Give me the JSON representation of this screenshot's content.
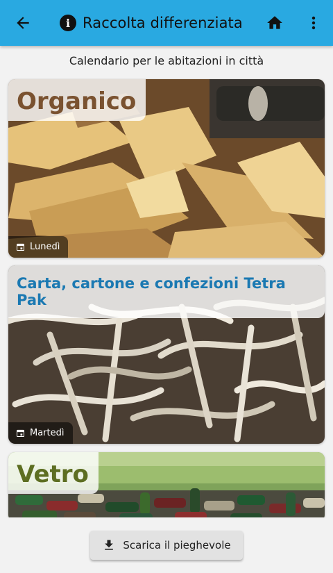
{
  "appbar": {
    "title": "Raccolta differenziata",
    "back_icon": "arrow-back-icon",
    "info_icon": "info-icon",
    "home_icon": "home-icon",
    "more_icon": "more-vert-icon",
    "color": "#29a9e1"
  },
  "subtitle": "Calendario per le abitazioni in città",
  "cards": [
    {
      "title": "Organico",
      "day": "Lunedì",
      "title_color": "#7a5230",
      "image": "potato-peels"
    },
    {
      "title": "Carta, cartone e confezioni Tetra Pak",
      "day": "Martedì",
      "title_color": "#1b79b2",
      "image": "shredded-paper"
    },
    {
      "title": "Vetro",
      "title_color": "#5d6e22",
      "image": "glass-bottles"
    }
  ],
  "download_button": {
    "label": "Scarica il pieghevole",
    "icon": "download-icon"
  }
}
